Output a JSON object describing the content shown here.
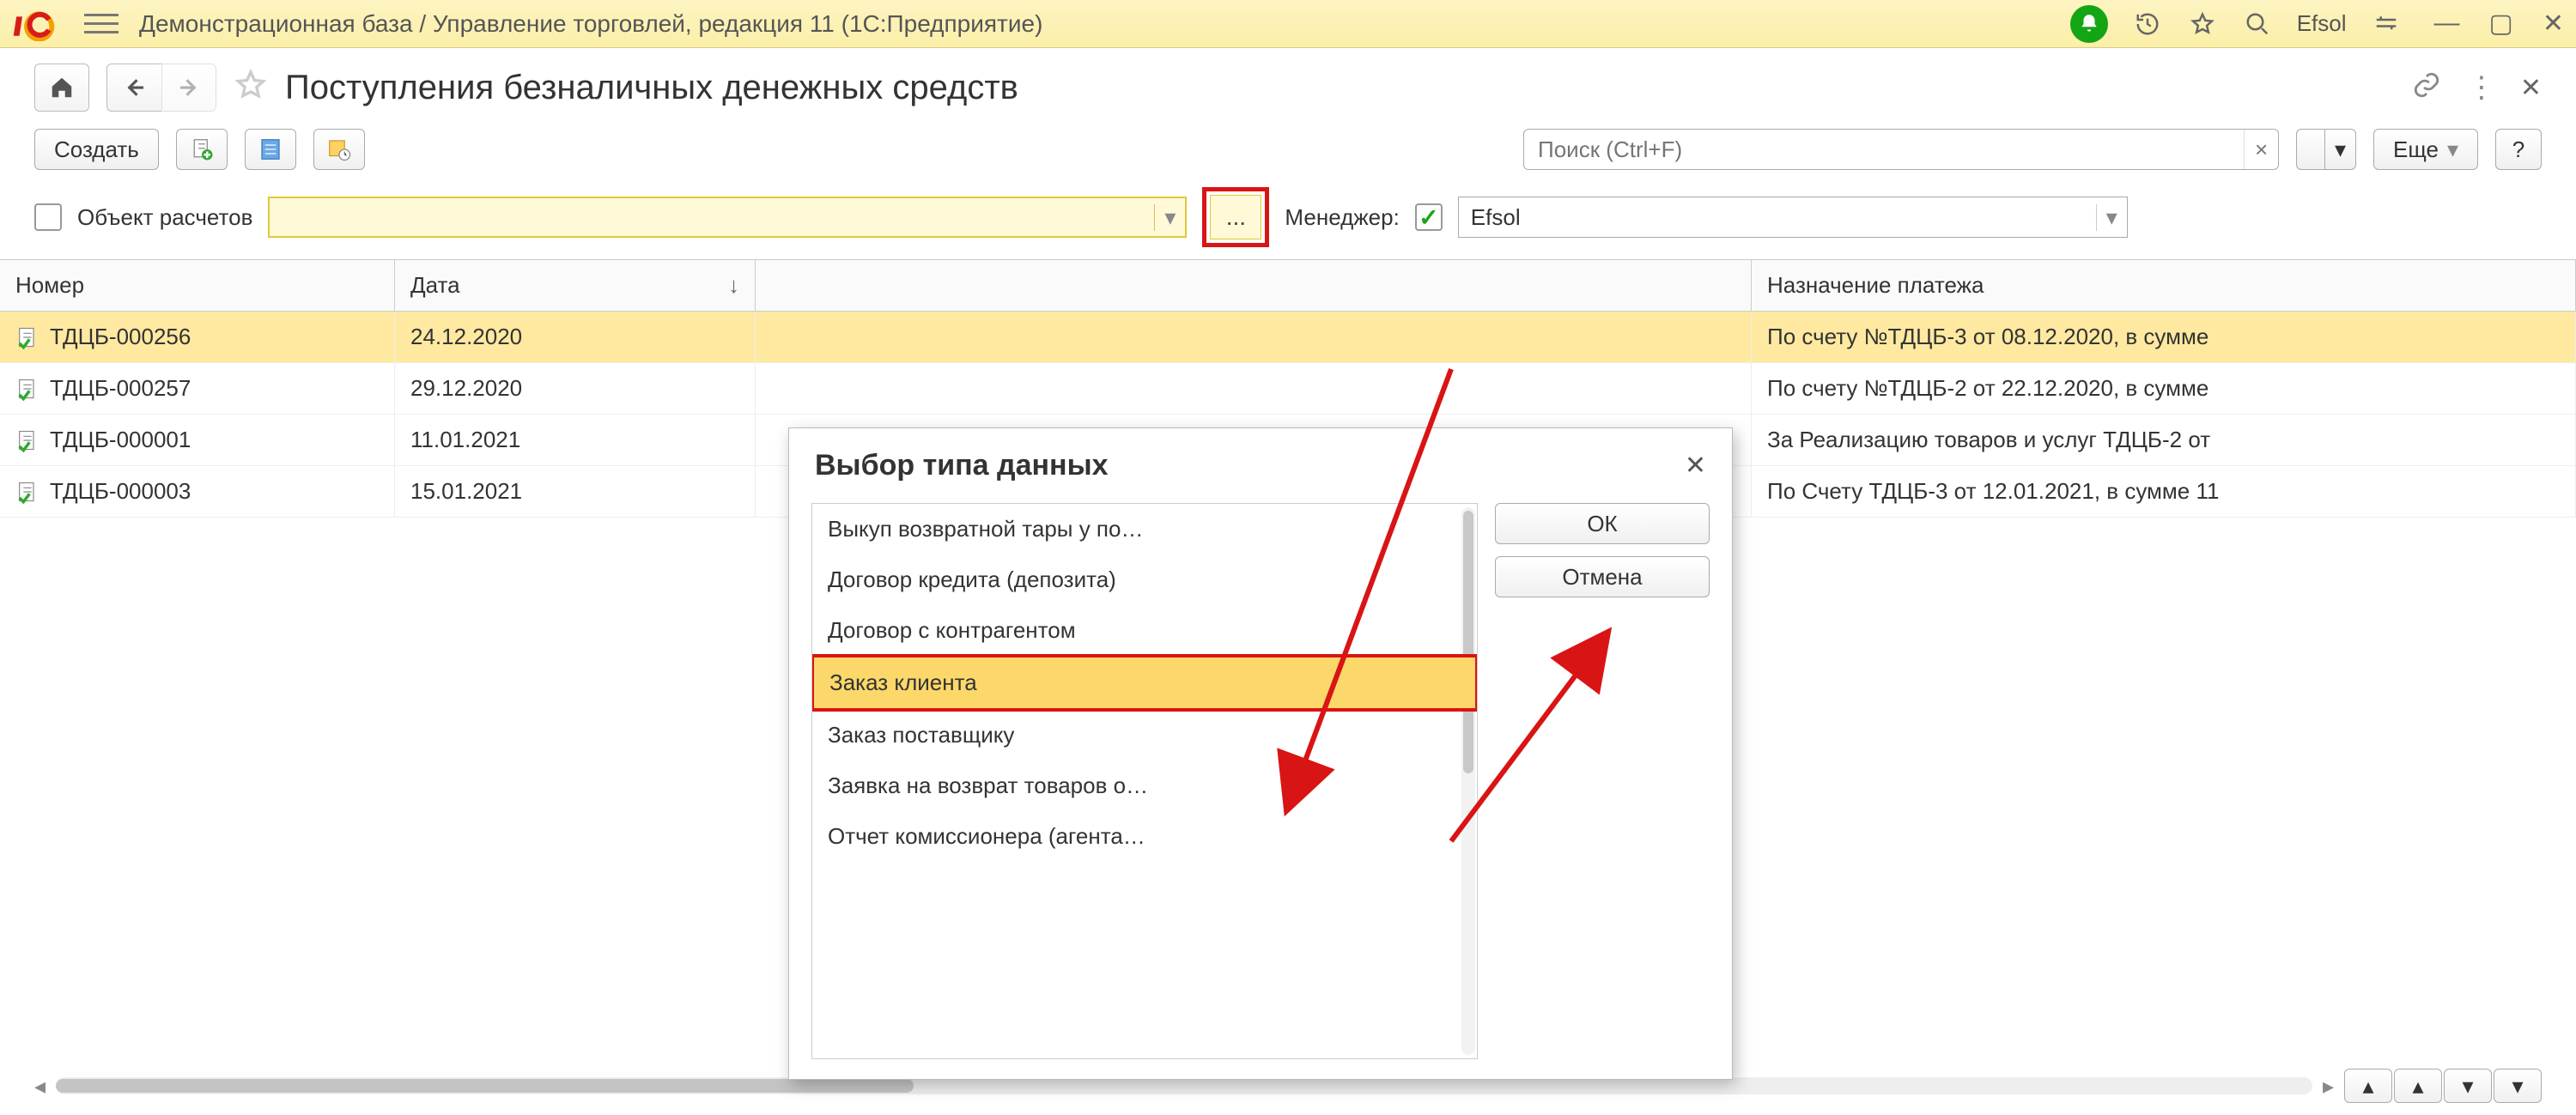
{
  "titlebar": {
    "title": "Демонстрационная база / Управление торговлей, редакция 11  (1С:Предприятие)",
    "user": "Efsol"
  },
  "page": {
    "title": "Поступления безналичных денежных средств"
  },
  "toolbar": {
    "create": "Создать",
    "more": "Еще",
    "search_placeholder": "Поиск (Ctrl+F)"
  },
  "filters": {
    "object_label": "Объект расчетов",
    "object_value": "",
    "ellipsis": "...",
    "manager_label": "Менеджер:",
    "manager_value": "Efsol"
  },
  "columns": {
    "number": "Номер",
    "date": "Дата",
    "purpose": "Назначение платежа"
  },
  "rows": [
    {
      "number": "ТДЦБ-000256",
      "date": "24.12.2020",
      "purpose": "По счету №ТДЦБ-3 от 08.12.2020, в сумме"
    },
    {
      "number": "ТДЦБ-000257",
      "date": "29.12.2020",
      "purpose": "По счету №ТДЦБ-2 от 22.12.2020, в сумме"
    },
    {
      "number": "ТДЦБ-000001",
      "date": "11.01.2021",
      "purpose": "За Реализацию товаров и услуг ТДЦБ-2 от"
    },
    {
      "number": "ТДЦБ-000003",
      "date": "15.01.2021",
      "purpose": "По Счету ТДЦБ-3 от 12.01.2021, в сумме 11"
    }
  ],
  "popup": {
    "title": "Выбор типа данных",
    "ok": "ОК",
    "cancel": "Отмена",
    "items": [
      "Выкуп возвратной тары у по…",
      "Договор кредита (депозита)",
      "Договор с контрагентом",
      "Заказ клиента",
      "Заказ поставщику",
      "Заявка на возврат товаров о…",
      "Отчет комиссионера (агента…"
    ],
    "highlight_index": 3
  }
}
